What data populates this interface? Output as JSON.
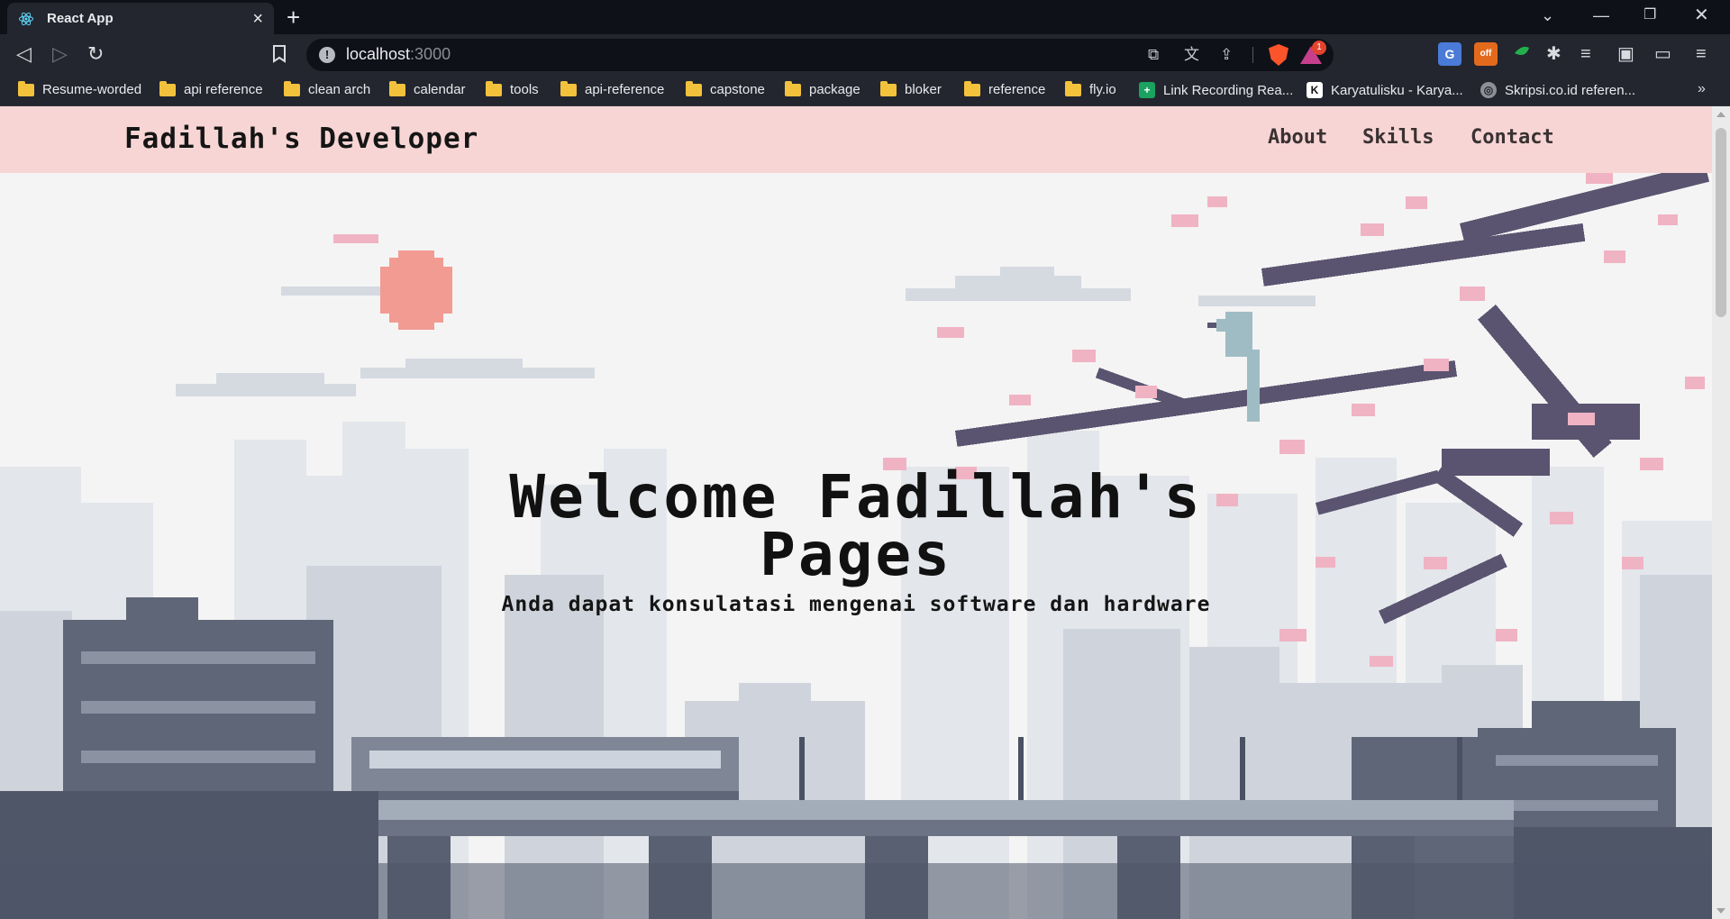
{
  "browser": {
    "tab": {
      "title": "React App",
      "favicon": "react-logo-icon"
    },
    "address": {
      "host": "localhost",
      "port": ":3000",
      "security_icon": "info-icon"
    },
    "window_controls": [
      "chevron-down-icon",
      "minimize-icon",
      "restore-icon",
      "close-icon"
    ],
    "extensions": [
      {
        "name": "google-translate-extension",
        "label": "G"
      },
      {
        "name": "off-extension",
        "label": "off"
      },
      {
        "name": "green-leaf-extension",
        "label": ""
      }
    ],
    "rewards_badge": "1",
    "bookmarks": [
      {
        "label": "Resume-worded",
        "icon": "folder-icon"
      },
      {
        "label": "api reference",
        "icon": "folder-icon"
      },
      {
        "label": "clean arch",
        "icon": "folder-icon"
      },
      {
        "label": "calendar",
        "icon": "folder-icon"
      },
      {
        "label": "tools",
        "icon": "folder-icon"
      },
      {
        "label": "api-reference",
        "icon": "folder-icon"
      },
      {
        "label": "capstone",
        "icon": "folder-icon"
      },
      {
        "label": "package",
        "icon": "folder-icon"
      },
      {
        "label": "bloker",
        "icon": "folder-icon"
      },
      {
        "label": "reference",
        "icon": "folder-icon"
      },
      {
        "label": "fly.io",
        "icon": "folder-icon"
      },
      {
        "label": "Link Recording Rea...",
        "icon": "green-plus-icon"
      },
      {
        "label": "Karyatulisku - Karya...",
        "icon": "k-logo-icon"
      },
      {
        "label": "Skripsi.co.id referen...",
        "icon": "globe-icon"
      }
    ]
  },
  "page": {
    "brand": "Fadillah's Developer",
    "nav": [
      "About",
      "Skills",
      "Contact"
    ],
    "hero": {
      "title": "Welcome Fadillah's Pages",
      "subtitle": "Anda dapat konsulatasi mengenai software dan hardware"
    },
    "colors": {
      "header_bg": "#f8d5d5",
      "sun": "#f29b92",
      "branch": "#5a5470",
      "blossom": "#f0b3c4",
      "bird": "#9fbcc4",
      "city_far": "#d7dbe2",
      "city_near": "#5e6677"
    }
  }
}
